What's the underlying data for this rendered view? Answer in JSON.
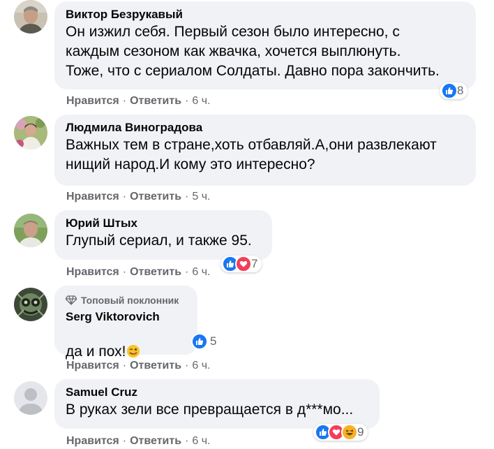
{
  "colors": {
    "like": "#1877f2",
    "love": "#f33e58",
    "haha": "#f7b125",
    "bubble": "#f0f2f5",
    "muted": "#65676b"
  },
  "actions": {
    "like_label": "Нравится",
    "reply_label": "Ответить",
    "separator": "·"
  },
  "comments": [
    {
      "author": "Виктор Безрукавый",
      "text": "Он изжил себя. Первый сезон было интересно, с\nкаждым сезоном как жвачка, хочется выплюнуть.\nТоже, что с сериалом Солдаты. Давно пора закончить.",
      "time": "6 ч.",
      "reactions": [
        "like"
      ],
      "reaction_count": "8"
    },
    {
      "author": "Людмила Виноградова",
      "text": "Важных тем в стране,хоть отбавляй.А,они развлекают\nнищий народ.И кому это интересно?",
      "time": "5 ч."
    },
    {
      "author": "Юрий Штых",
      "text": "Глупый сериал, и также 95.",
      "time": "6 ч.",
      "reactions": [
        "like",
        "love"
      ],
      "reaction_count": "7"
    },
    {
      "badge": "Топовый поклонник",
      "author": "Serg Viktorovich",
      "text": "да и пох!",
      "time": "6 ч.",
      "reactions": [
        "like"
      ],
      "reaction_count": "5"
    },
    {
      "author": "Samuel Cruz",
      "text": "В руках зели все превращается в д***мо...",
      "time": "6 ч.",
      "reactions": [
        "like",
        "love",
        "haha"
      ],
      "reaction_count": "9"
    }
  ]
}
